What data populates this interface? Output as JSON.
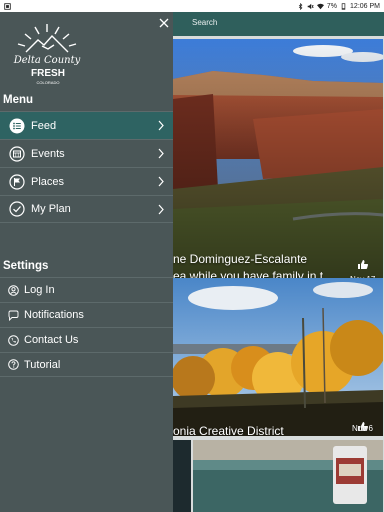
{
  "status_bar": {
    "battery": "7%",
    "time": "12:06 PM"
  },
  "topbar": {
    "search_label": "Search"
  },
  "logo": {
    "line1": "Delta County",
    "line2": "FRESH",
    "line3": "COLORADO"
  },
  "drawer": {
    "menu_title": "Menu",
    "menu_items": [
      {
        "label": "Feed",
        "icon": "list-icon",
        "active": true
      },
      {
        "label": "Events",
        "icon": "calendar-icon",
        "active": false
      },
      {
        "label": "Places",
        "icon": "flag-icon",
        "active": false
      },
      {
        "label": "My Plan",
        "icon": "check-circle-icon",
        "active": false
      }
    ],
    "settings_title": "Settings",
    "settings_items": [
      {
        "label": "Log In",
        "icon": "login-icon"
      },
      {
        "label": "Notifications",
        "icon": "chat-bubble-icon"
      },
      {
        "label": "Contact Us",
        "icon": "phone-icon"
      },
      {
        "label": "Tutorial",
        "icon": "help-icon"
      }
    ]
  },
  "feed": {
    "cards": [
      {
        "title_line1": "ne Dominguez-Escalante",
        "title_line2": "ea while you have family in t…",
        "date": "Nov 17"
      },
      {
        "title_line1": "onia Creative District",
        "date": "Nov 6"
      }
    ]
  },
  "colors": {
    "drawer_bg": "#4a5657",
    "active_item": "#2e6362",
    "topbar": "#2f5f5c"
  }
}
